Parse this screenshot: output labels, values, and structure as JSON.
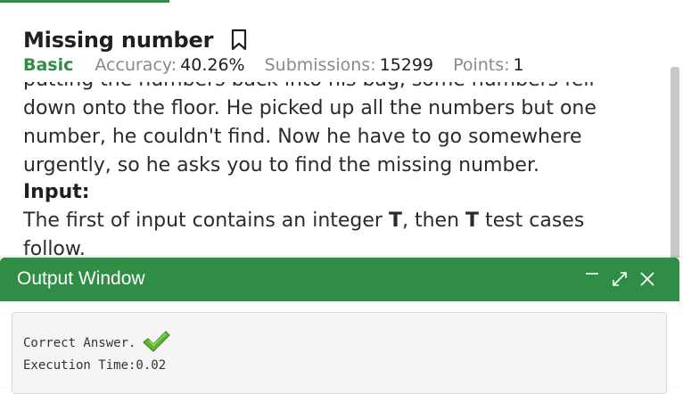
{
  "problem": {
    "title": "Missing number",
    "difficulty": "Basic",
    "accuracy_label": "Accuracy:",
    "accuracy_value": "40.26%",
    "submissions_label": "Submissions:",
    "submissions_value": "15299",
    "points_label": "Points:",
    "points_value": "1"
  },
  "description": {
    "paragraph": "putting the numbers back into his bag, some numbers fell down onto the floor. He picked up all the numbers but one number, he couldn't find. Now he have to go somewhere urgently, so he asks you to find the missing number.",
    "input_heading": "Input:",
    "input_text_1": "The first of input contains an integer ",
    "input_var_1": "T",
    "input_text_2": ", then ",
    "input_var_2": "T",
    "input_text_3": " test cases follow."
  },
  "output_window": {
    "title": "Output Window",
    "result_text": "Correct Answer.",
    "time_text": "Execution Time:0.02"
  },
  "colors": {
    "accent": "#2f8d46"
  },
  "icons": {
    "bookmark": "bookmark-icon",
    "minimize": "minimize-icon",
    "expand": "expand-icon",
    "close": "close-icon",
    "check": "checkmark-icon"
  }
}
